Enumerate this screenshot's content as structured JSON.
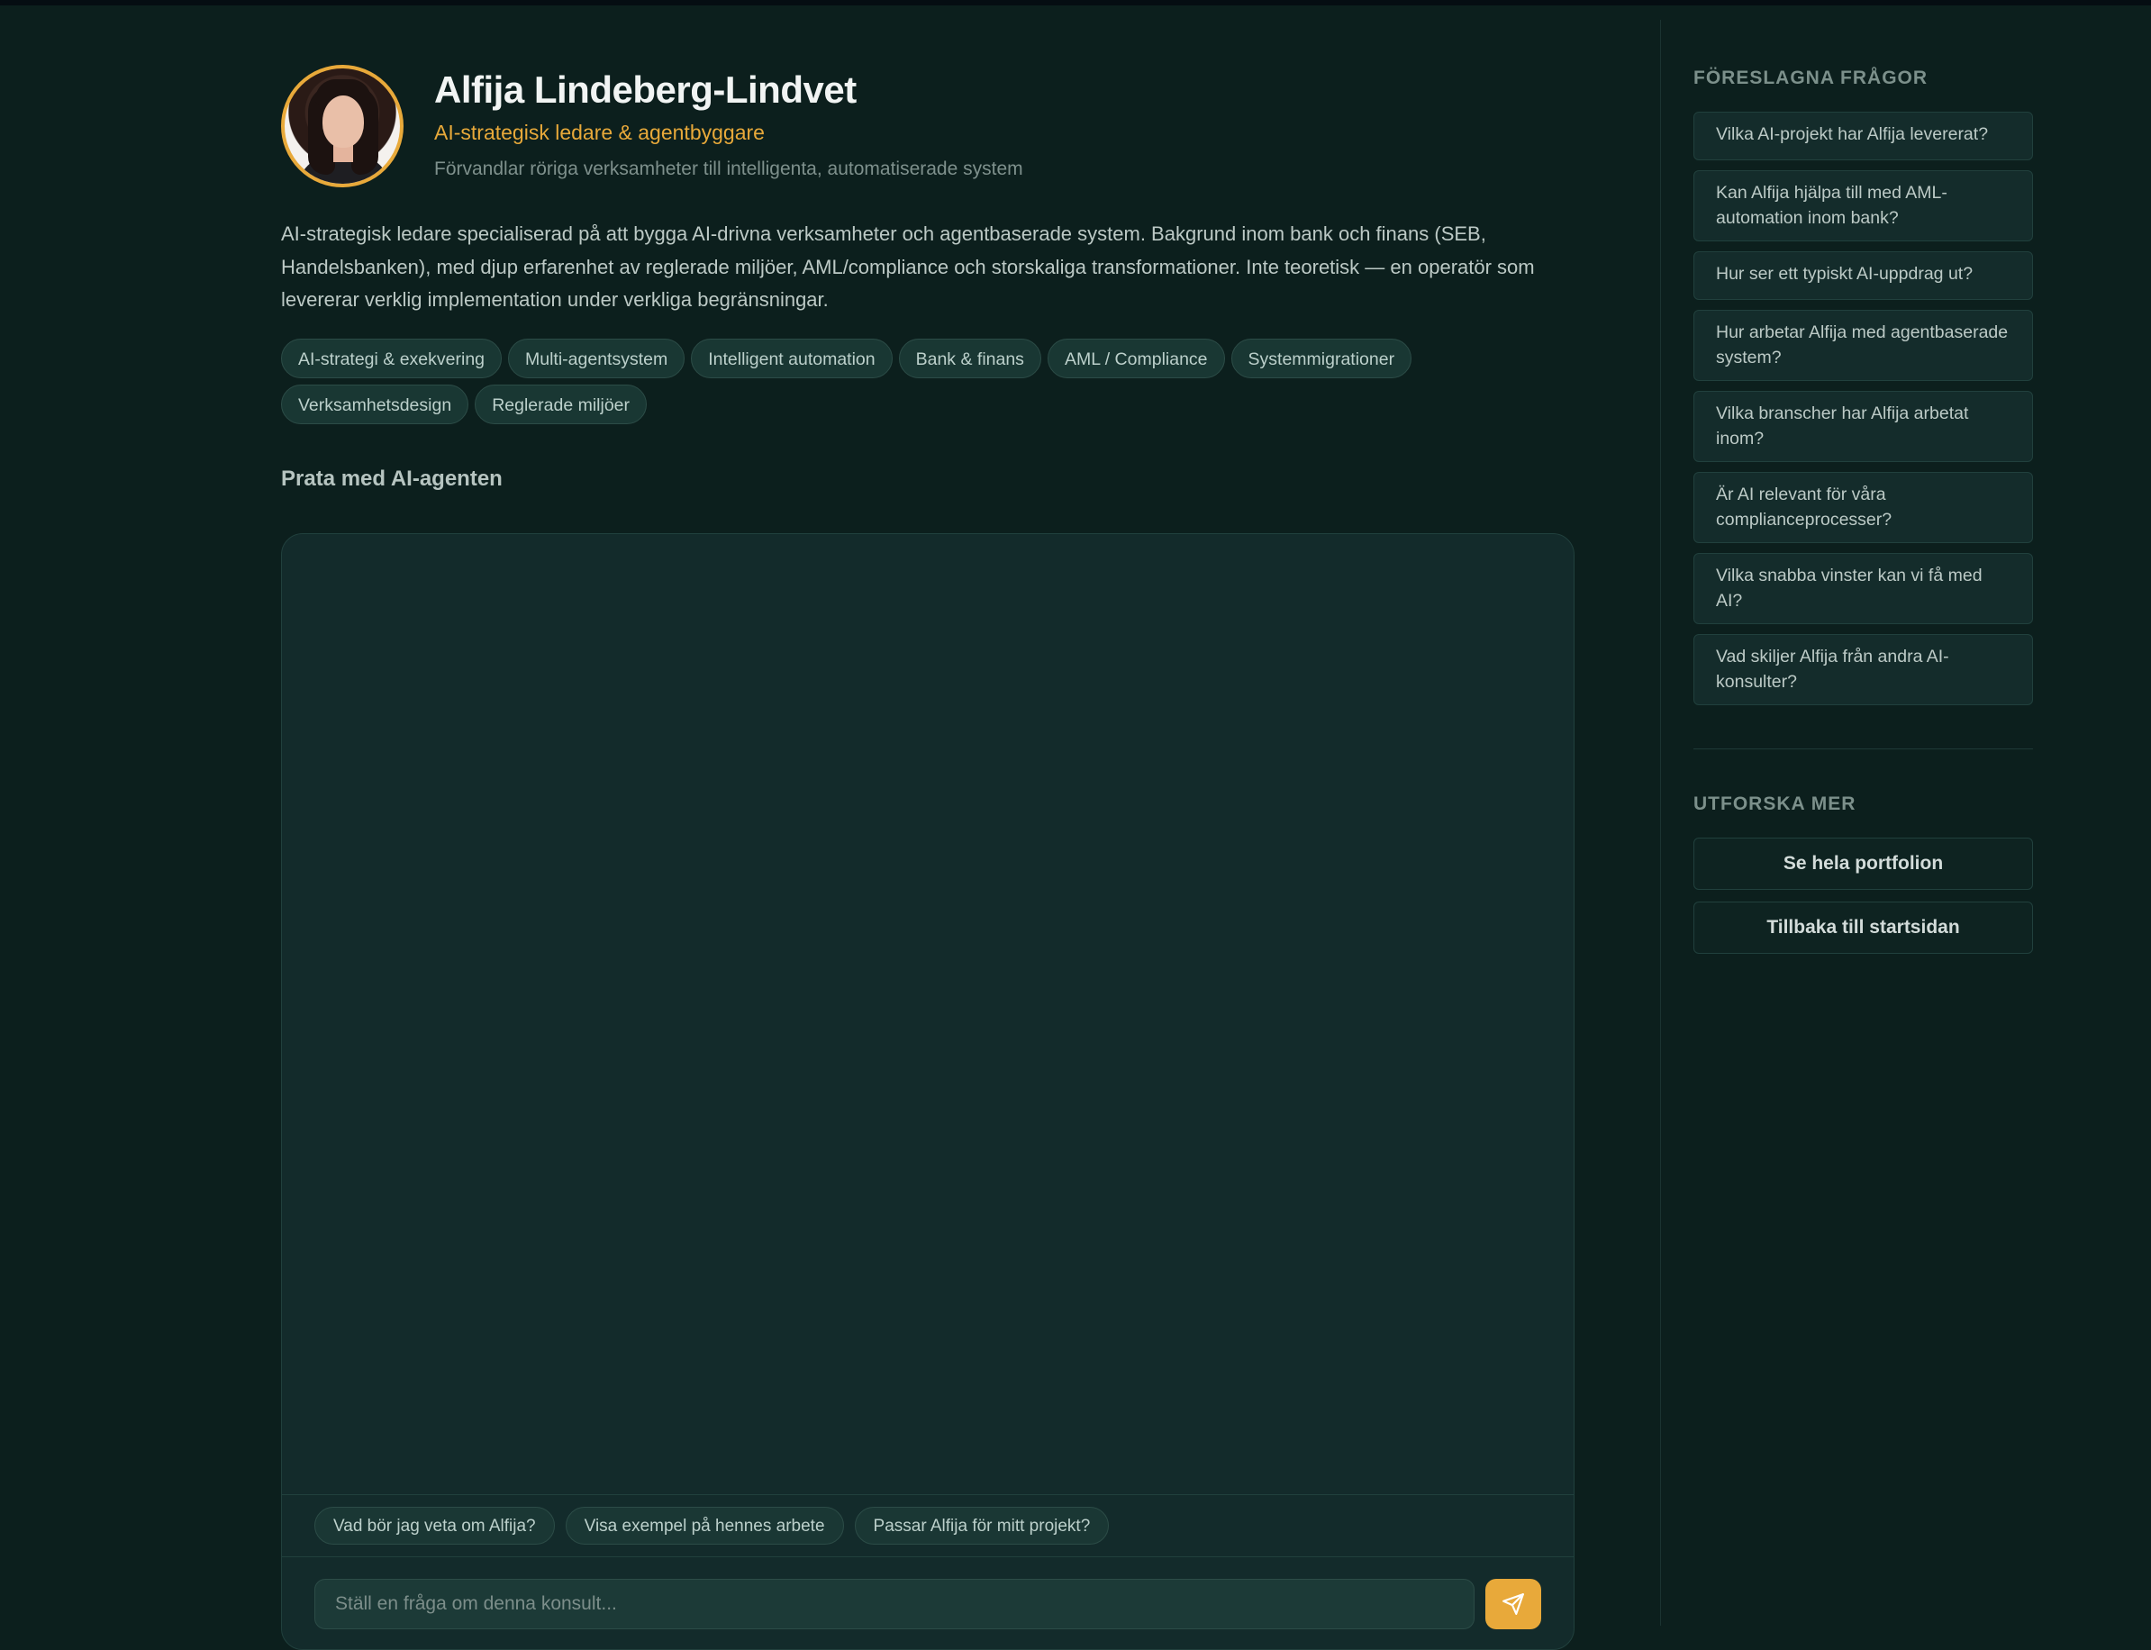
{
  "profile": {
    "name": "Alfija Lindeberg-Lindvet",
    "role": "AI-strategisk ledare & agentbyggare",
    "tagline": "Förvandlar röriga verksamheter till intelligenta, automatiserade system",
    "bio": "AI-strategisk ledare specialiserad på att bygga AI-drivna verksamheter och agentbaserade system. Bakgrund inom bank och finans (SEB, Handelsbanken), med djup erfarenhet av reglerade miljöer, AML/compliance och storskaliga transformationer. Inte teoretisk — en operatör som levererar verklig implementation under verkliga begränsningar.",
    "tags": [
      "AI-strategi & exekvering",
      "Multi-agentsystem",
      "Intelligent automation",
      "Bank & finans",
      "AML / Compliance",
      "Systemmigrationer",
      "Verksamhetsdesign",
      "Reglerade miljöer"
    ]
  },
  "chat": {
    "heading": "Prata med AI-agenten",
    "suggestions": [
      "Vad bör jag veta om Alfija?",
      "Visa exempel på hennes arbete",
      "Passar Alfija för mitt projekt?"
    ],
    "input_placeholder": "Ställ en fråga om denna konsult...",
    "input_value": "",
    "send_icon": "paper-plane-icon"
  },
  "sidebar": {
    "suggested_heading": "FÖRESLAGNA FRÅGOR",
    "questions": [
      "Vilka AI-projekt har Alfija levererat?",
      "Kan Alfija hjälpa till med AML-automation inom bank?",
      "Hur ser ett typiskt AI-uppdrag ut?",
      "Hur arbetar Alfija med agentbaserade system?",
      "Vilka branscher har Alfija arbetat inom?",
      "Är AI relevant för våra complianceprocesser?",
      "Vilka snabba vinster kan vi få med AI?",
      "Vad skiljer Alfija från andra AI-konsulter?"
    ],
    "explore_heading": "UTFORSKA MER",
    "portfolio_label": "Se hela portfolion",
    "home_label": "Tillbaka till startsidan"
  },
  "colors": {
    "background": "#0c1f1d",
    "accent": "#e8a93a",
    "panel": "#132b2b"
  }
}
